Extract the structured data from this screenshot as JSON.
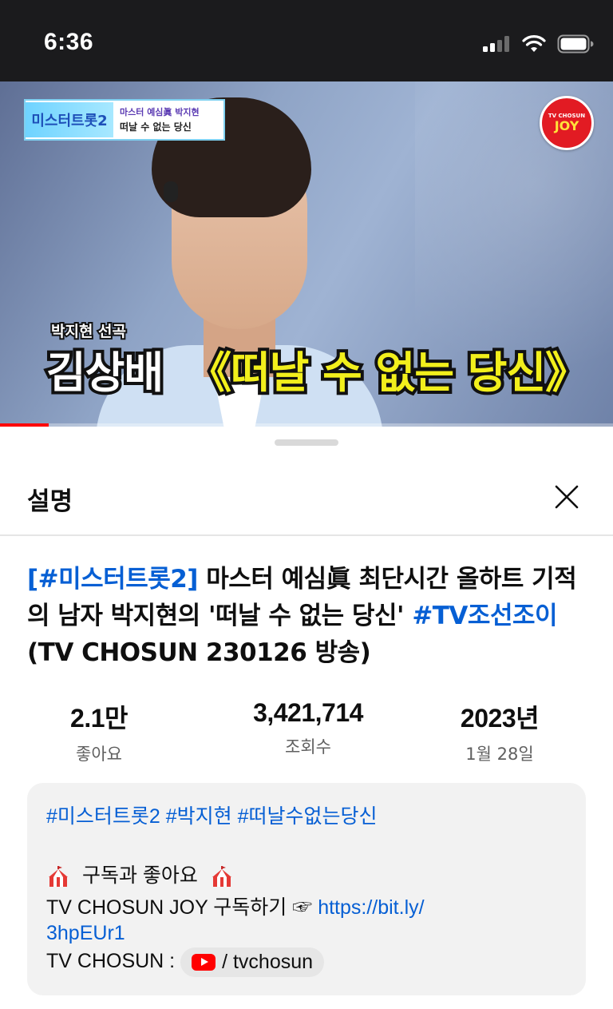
{
  "status_bar": {
    "time": "6:36",
    "icons": [
      "signal-icon",
      "wifi-icon",
      "battery-icon"
    ]
  },
  "video": {
    "show_logo_name": "미스터트롯2",
    "show_logo_line1": "마스터 예심眞 박지현",
    "show_logo_line2": "떠날 수 없는 당신",
    "channel_badge_top": "TV CHOSUN",
    "channel_badge_name": "JOY",
    "caption_small": "박지현 선곡",
    "caption_artist": "김상배",
    "caption_song": "《떠날 수 없는 당신》",
    "progress_fraction": 0.08,
    "accent_color": "#ff0000"
  },
  "sheet": {
    "title": "설명",
    "close_icon": "close-icon"
  },
  "video_title": {
    "hashtag_open": "[#미스터트롯2]",
    "part1": " 마스터 예심眞 최단시간 올하트 기적의 남자 박지현의 '떠날 수 없는 당신' ",
    "hashtag_channel": "#TV조선조이",
    "part2": " (TV CHOSUN 230126 방송)"
  },
  "stats": [
    {
      "value": "2.1만",
      "label": "좋아요"
    },
    {
      "value": "3,421,714",
      "label": "조회수"
    },
    {
      "value": "2023년",
      "label": "1월 28일"
    }
  ],
  "description": {
    "hashtags": "#미스터트롯2 #박지현 #떠날수없는당신",
    "subscribe_line": "구독과 좋아요",
    "joy_text": "TV CHOSUN JOY 구독하기 ☞ ",
    "joy_link_part1": "https://bit.ly/",
    "joy_link_part2": "3hpEUr1",
    "chosun_label": "TV CHOSUN : ",
    "chosun_pill": "/ tvchosun",
    "link_color": "#065fd4"
  }
}
